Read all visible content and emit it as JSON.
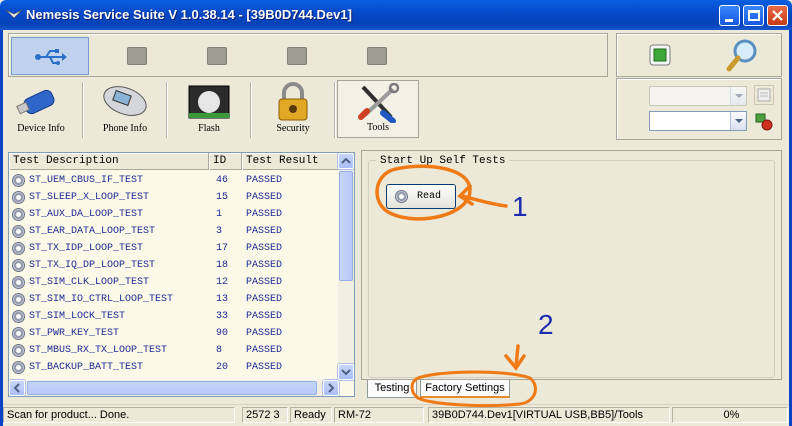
{
  "window": {
    "title": "Nemesis Service Suite V 1.0.38.14 - [39B0D744.Dev1]"
  },
  "categories": [
    {
      "label": "Device Info"
    },
    {
      "label": "Phone Info"
    },
    {
      "label": "Flash"
    },
    {
      "label": "Security"
    },
    {
      "label": "Tools"
    }
  ],
  "list": {
    "headers": [
      "Test Description",
      "ID",
      "Test Result"
    ],
    "rows": [
      {
        "name": "ST_UEM_CBUS_IF_TEST",
        "id": "46",
        "result": "PASSED"
      },
      {
        "name": "ST_SLEEP_X_LOOP_TEST",
        "id": "15",
        "result": "PASSED"
      },
      {
        "name": "ST_AUX_DA_LOOP_TEST",
        "id": "1",
        "result": "PASSED"
      },
      {
        "name": "ST_EAR_DATA_LOOP_TEST",
        "id": "3",
        "result": "PASSED"
      },
      {
        "name": "ST_TX_IDP_LOOP_TEST",
        "id": "17",
        "result": "PASSED"
      },
      {
        "name": "ST_TX_IQ_DP_LOOP_TEST",
        "id": "18",
        "result": "PASSED"
      },
      {
        "name": "ST_SIM_CLK_LOOP_TEST",
        "id": "12",
        "result": "PASSED"
      },
      {
        "name": "ST_SIM_IO_CTRL_LOOP_TEST",
        "id": "13",
        "result": "PASSED"
      },
      {
        "name": "ST_SIM_LOCK_TEST",
        "id": "33",
        "result": "PASSED"
      },
      {
        "name": "ST_PWR_KEY_TEST",
        "id": "90",
        "result": "PASSED"
      },
      {
        "name": "ST_MBUS_RX_TX_LOOP_TEST",
        "id": "8",
        "result": "PASSED"
      },
      {
        "name": "ST_BACKUP_BATT_TEST",
        "id": "20",
        "result": "PASSED"
      }
    ]
  },
  "selftest": {
    "group_title": "Start Up Self Tests",
    "read_label": "Read"
  },
  "tabs": [
    {
      "label": "Testing"
    },
    {
      "label": "Factory Settings"
    }
  ],
  "annotations": {
    "one": "1",
    "two": "2"
  },
  "status": {
    "message": "Scan for product... Done.",
    "code": "2572 3",
    "state": "Ready",
    "model": "RM-72",
    "connection": "39B0D744.Dev1[VIRTUAL USB,BB5]/Tools",
    "progress": "0%"
  },
  "colors": {
    "annotation": "#f07a16",
    "annotation_text": "#1c2db0",
    "title_bar": "#0548c8"
  }
}
